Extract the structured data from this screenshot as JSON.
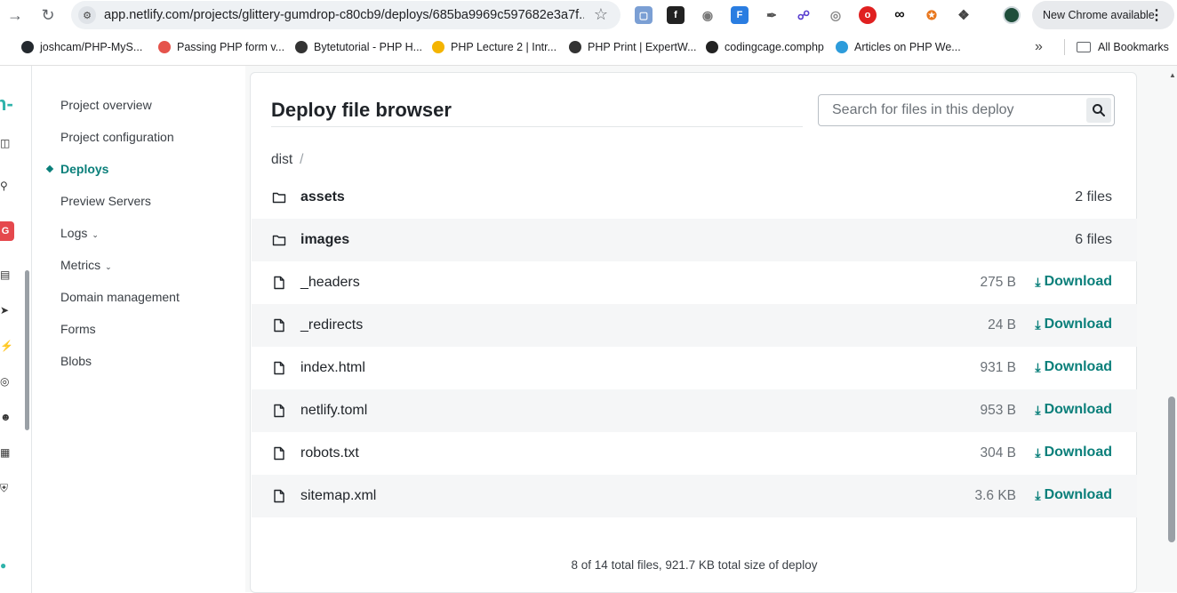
{
  "browser": {
    "url": "app.netlify.com/projects/glittery-gumdrop-c80cb9/deploys/685ba9969c597682e3a7f...",
    "new_chrome_label": "New Chrome available"
  },
  "bookmarks": [
    {
      "label": "joshcam/PHP-MyS...",
      "color": "#24292f"
    },
    {
      "label": "Passing PHP form v...",
      "color": "#e5534b"
    },
    {
      "label": "Bytetutorial - PHP H...",
      "color": "#333333"
    },
    {
      "label": "PHP Lecture 2 | Intr...",
      "color": "#f4b400"
    },
    {
      "label": "PHP Print | ExpertW...",
      "color": "#333333"
    },
    {
      "label": "codingcage.comphp",
      "color": "#222222"
    },
    {
      "label": "Articles on PHP We...",
      "color": "#2d9cdb"
    }
  ],
  "all_bookmarks_label": "All Bookmarks",
  "sidenav": {
    "items": [
      {
        "label": "Project overview"
      },
      {
        "label": "Project configuration"
      },
      {
        "label": "Deploys"
      },
      {
        "label": "Preview Servers"
      },
      {
        "label": "Logs"
      },
      {
        "label": "Metrics"
      },
      {
        "label": "Domain management"
      },
      {
        "label": "Forms"
      },
      {
        "label": "Blobs"
      }
    ]
  },
  "browser_panel": {
    "title": "Deploy file browser",
    "search_placeholder": "Search for files in this deploy",
    "breadcrumb": "dist",
    "breadcrumb_sep": "/",
    "download_label": "Download",
    "rows": [
      {
        "name": "assets",
        "type": "folder",
        "meta": "2 files"
      },
      {
        "name": "images",
        "type": "folder",
        "meta": "6 files"
      },
      {
        "name": "_headers",
        "type": "file",
        "meta": "275 B"
      },
      {
        "name": "_redirects",
        "type": "file",
        "meta": "24 B"
      },
      {
        "name": "index.html",
        "type": "file",
        "meta": "931 B"
      },
      {
        "name": "netlify.toml",
        "type": "file",
        "meta": "953 B"
      },
      {
        "name": "robots.txt",
        "type": "file",
        "meta": "304 B"
      },
      {
        "name": "sitemap.xml",
        "type": "file",
        "meta": "3.6 KB"
      }
    ],
    "summary": "8 of 14 total files, 921.7 KB total size of deploy"
  },
  "colors": {
    "accent": "#0a7f7a",
    "brand": "#2fb3ab"
  }
}
